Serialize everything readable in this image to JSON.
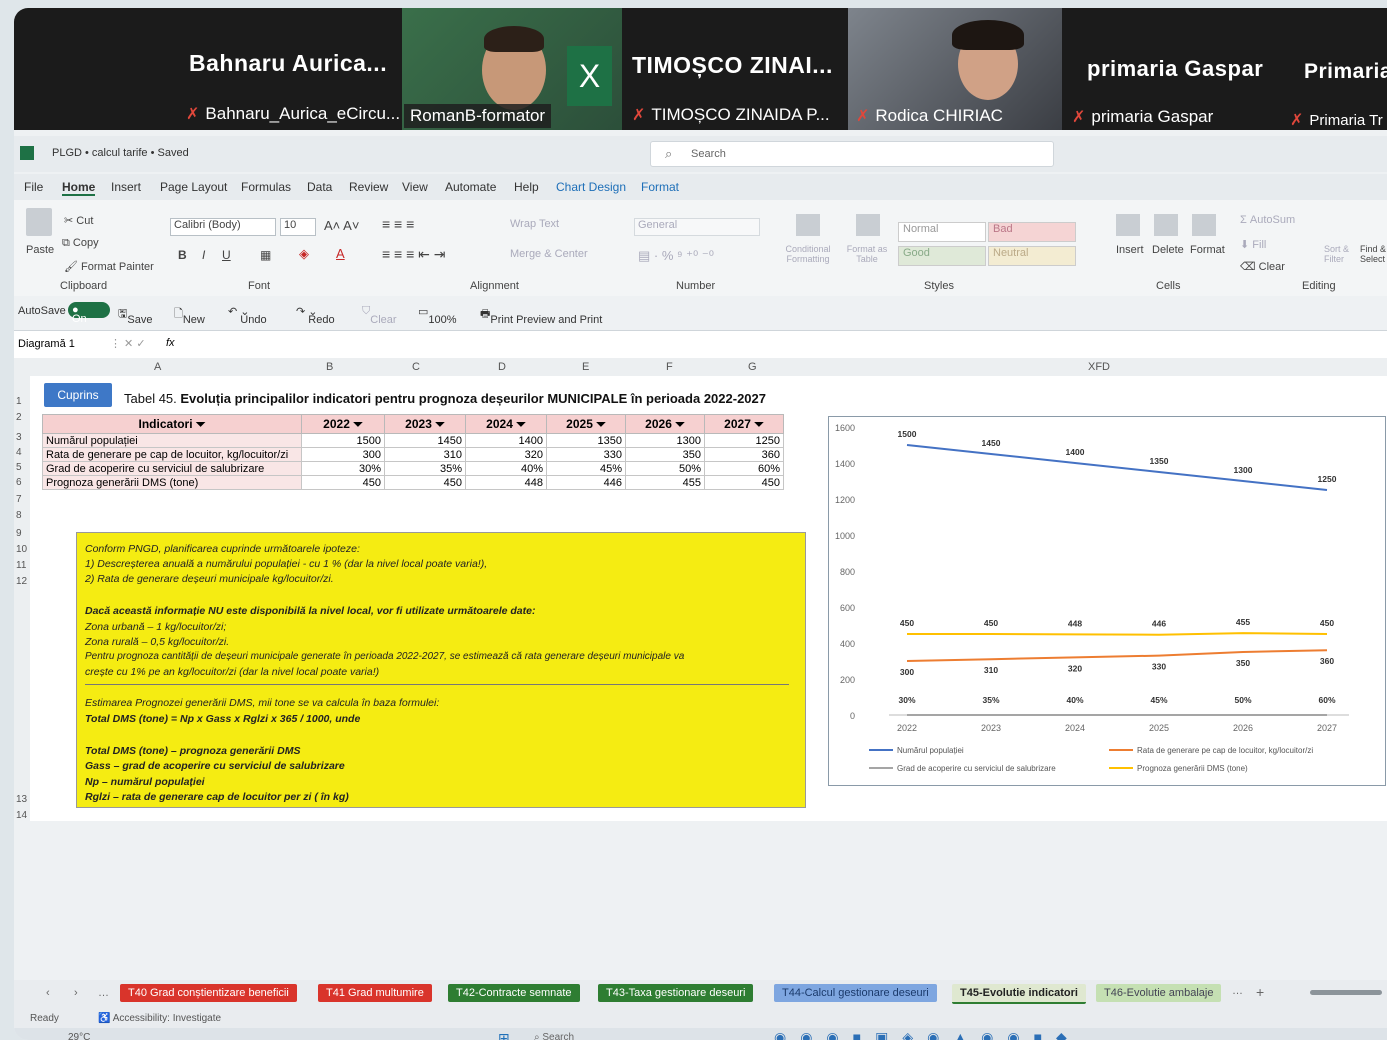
{
  "meeting": {
    "tiles": [
      {
        "name": "Bahnaru  Aurica...",
        "label": "Bahnaru_Aurica_eCircu..."
      },
      {
        "name": "",
        "label": "RomanB-formator"
      },
      {
        "name": "TIMOȘCO  ZINAI...",
        "label": "TIMOȘCO ZINAIDA  P..."
      },
      {
        "name": "",
        "label": "Rodica CHIRIAC"
      },
      {
        "name": "primaria Gaspar",
        "label": "primaria Gaspar"
      },
      {
        "name": "Primaria",
        "label": "Primaria Tr"
      }
    ]
  },
  "excel": {
    "file_title": "PLGD • calcul tarife • Saved",
    "search_placeholder": "Search",
    "menu": [
      "File",
      "Home",
      "Insert",
      "Page Layout",
      "Formulas",
      "Data",
      "Review",
      "View",
      "Automate",
      "Help",
      "Chart Design",
      "Format"
    ],
    "ribbon": {
      "paste": "Paste",
      "cut": "Cut",
      "copy": "Copy",
      "format_painter": "Format Painter",
      "clipboard": "Clipboard",
      "font_name": "Calibri (Body)",
      "font_size": "10",
      "font_group": "Font",
      "wrap_text": "Wrap Text",
      "merge_center": "Merge & Center",
      "alignment": "Alignment",
      "number_format": "General",
      "number": "Number",
      "conditional": "Conditional Formatting",
      "format_table": "Format as Table",
      "style_normal": "Normal",
      "style_bad": "Bad",
      "style_good": "Good",
      "style_neutral": "Neutral",
      "styles": "Styles",
      "insert": "Insert",
      "delete": "Delete",
      "format": "Format",
      "cells": "Cells",
      "autosum": "AutoSum",
      "fill": "Fill",
      "clear": "Clear",
      "sort_filter": "Sort & Filter",
      "find_select": "Find & Select",
      "editing": "Editing"
    },
    "qat": {
      "autosave": "AutoSave",
      "toggle": "On",
      "save": "Save",
      "new": "New",
      "undo": "Undo",
      "redo": "Redo",
      "clear": "Clear",
      "zoom": "100%",
      "print_preview": "Print Preview and Print"
    },
    "name_box": "Diagramă 1",
    "fx": "fx",
    "columns": [
      "A",
      "B",
      "C",
      "D",
      "E",
      "F",
      "G",
      "XFD"
    ],
    "rows": [
      "1",
      "2",
      "3",
      "4",
      "5",
      "6",
      "7",
      "8",
      "9",
      "10",
      "11",
      "12",
      "13",
      "14"
    ],
    "cuprins": "Cuprins",
    "table_title_prefix": "Tabel 45.",
    "table_title": "Evoluția principalilor indicatori pentru prognoza deșeurilor MUNICIPALE în perioada 2022-2027",
    "headers": [
      "Indicatori",
      "2022",
      "2023",
      "2024",
      "2025",
      "2026",
      "2027"
    ],
    "table_rows": [
      {
        "label": "Numărul populației",
        "values": [
          "1500",
          "1450",
          "1400",
          "1350",
          "1300",
          "1250"
        ]
      },
      {
        "label": "Rata de generare pe cap de locuitor, kg/locuitor/zi",
        "values": [
          "300",
          "310",
          "320",
          "330",
          "350",
          "360"
        ]
      },
      {
        "label": "Grad de acoperire cu serviciul de salubrizare",
        "values": [
          "30%",
          "35%",
          "40%",
          "45%",
          "50%",
          "60%"
        ]
      },
      {
        "label": "Prognoza generării DMS (tone)",
        "values": [
          "450",
          "450",
          "448",
          "446",
          "455",
          "450"
        ]
      }
    ],
    "note": [
      "Conform PNGD, planificarea cuprinde următoarele ipoteze:",
      "1) Descreșterea anuală a numărului populației - cu 1 % (dar la nivel local poate varia!),",
      "2) Rata de generare deșeuri municipale kg/locuitor/zi.",
      "Dacă această informație NU este disponibilă la nivel local, vor fi utilizate următoarele date:",
      "Zona urbană – 1 kg/locuitor/zi;",
      "Zona rurală – 0,5 kg/locuitor/zi.",
      "Pentru prognoza cantității de deșeuri municipale generate în perioada 2022-2027, se estimează că rata generare deșeuri municipale va",
      "crește cu 1% pe an kg/locuitor/zi (dar la nivel local poate varia!)",
      "Estimarea Prognozei generării DMS, mii tone se va calcula în baza formulei:",
      "Total DMS (tone) = Np x Gass x Rglzi x 365 / 1000, unde",
      "Total DMS (tone) – prognoza generării DMS",
      "Gass – grad de acoperire cu serviciul de salubrizare",
      "Np – numărul populației",
      "Rglzi – rata de generare cap de locuitor per zi ( în kg)"
    ],
    "sheet_tabs": [
      {
        "label": "T40 Grad conștientizare beneficii",
        "color": "#d9342b"
      },
      {
        "label": "T41 Grad multumire",
        "color": "#d9342b"
      },
      {
        "label": "T42-Contracte semnate",
        "color": "#2e7d32"
      },
      {
        "label": "T43-Taxa gestionare deseuri",
        "color": "#2e7d32"
      },
      {
        "label": "T44-Calcul gestionare deseuri",
        "color": "#7ea6e0"
      },
      {
        "label": "T45-Evolutie indicatori",
        "color": "#dfe8d0"
      },
      {
        "label": "T46-Evolutie ambalaje",
        "color": "#c5e0b3"
      }
    ],
    "status": {
      "ready": "Ready",
      "accessibility": "Accessibility: Investigate"
    },
    "taskbar": {
      "temp": "29°C",
      "search": "Search"
    }
  },
  "chart_data": {
    "type": "line",
    "categories": [
      "2022",
      "2023",
      "2024",
      "2025",
      "2026",
      "2027"
    ],
    "ylim": [
      0,
      1600
    ],
    "yticks": [
      0,
      200,
      400,
      600,
      800,
      1000,
      1200,
      1400,
      1600
    ],
    "series": [
      {
        "name": "Numărul populației",
        "values": [
          1500,
          1450,
          1400,
          1350,
          1300,
          1250
        ],
        "color": "#4472c4",
        "labels": [
          "1500",
          "1450",
          "1400",
          "1350",
          "1300",
          "1250"
        ]
      },
      {
        "name": "Rata de generare pe cap de locuitor, kg/locuitor/zi",
        "values": [
          300,
          310,
          320,
          330,
          350,
          360
        ],
        "color": "#ed7d31",
        "labels": [
          "300",
          "310",
          "320",
          "330",
          "350",
          "360"
        ]
      },
      {
        "name": "Grad de acoperire cu serviciul de salubrizare",
        "values": [
          0.3,
          0.35,
          0.4,
          0.45,
          0.5,
          0.6
        ],
        "color": "#a5a5a5",
        "labels": [
          "30%",
          "35%",
          "40%",
          "45%",
          "50%",
          "60%"
        ]
      },
      {
        "name": "Prognoza generării DMS (tone)",
        "values": [
          450,
          450,
          448,
          446,
          455,
          450
        ],
        "color": "#ffc000",
        "labels": [
          "450",
          "450",
          "448",
          "446",
          "455",
          "450"
        ]
      }
    ],
    "legend": "bottom",
    "grid": false
  }
}
